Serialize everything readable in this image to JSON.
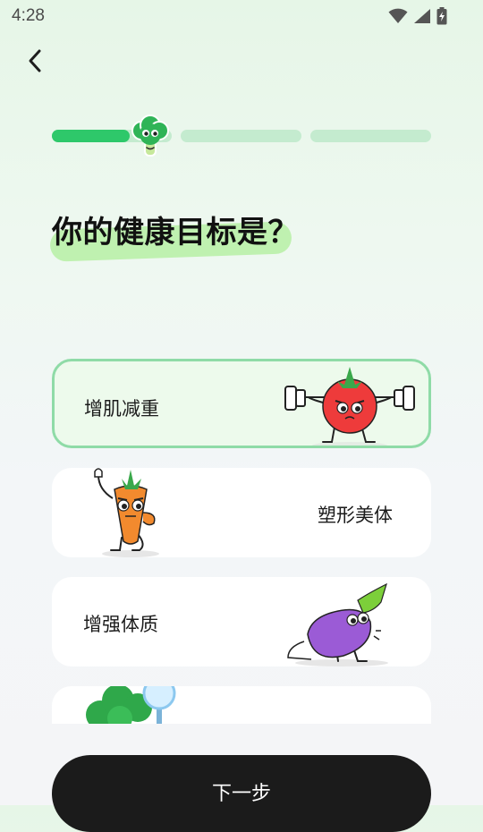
{
  "status_bar": {
    "time": "4:28"
  },
  "header": {
    "back_icon": "chevron-left-icon"
  },
  "progress": {
    "steps": 3,
    "current_step": 1,
    "current_step_fill": 0.65,
    "mascot_icon": "broccoli-mascot-icon"
  },
  "title": "你的健康目标是？",
  "options": [
    {
      "label": "增肌减重",
      "illustration": "tomato-weightlifting-icon",
      "selected": true
    },
    {
      "label": "塑形美体",
      "illustration": "carrot-flexing-icon",
      "selected": false
    },
    {
      "label": "增强体质",
      "illustration": "eggplant-pushup-icon",
      "selected": false
    },
    {
      "label": "",
      "illustration": "broccoli-magnifier-icon",
      "selected": false
    }
  ],
  "footer": {
    "next_label": "下一步"
  },
  "colors": {
    "accent": "#2ec86a",
    "track": "#c4ebcf",
    "selected_border": "#8fdba7",
    "button": "#1b1b1b"
  }
}
